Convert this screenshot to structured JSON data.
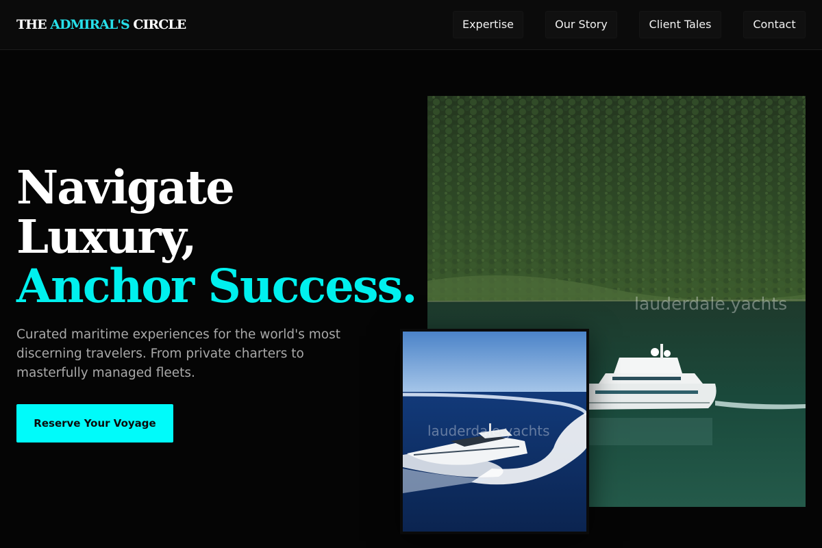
{
  "brand": {
    "part1": "THE",
    "part2": "ADMIRAL'S",
    "part3": "CIRCLE",
    "accent_color": "#27e0ea"
  },
  "nav": {
    "items": [
      {
        "label": "Expertise"
      },
      {
        "label": "Our Story"
      },
      {
        "label": "Client Tales"
      },
      {
        "label": "Contact"
      }
    ]
  },
  "hero": {
    "line1": "Navigate",
    "line2": "Luxury,",
    "line3": "Anchor Success.",
    "accent_color": "#00f0ee",
    "subtext": "Curated maritime experiences for the world's most discerning travelers. From private charters to masterfully managed fleets.",
    "cta_label": "Reserve Your Voyage",
    "cta_color": "#00fbfa"
  },
  "images": {
    "large": {
      "watermark": "lauderdale.yachts",
      "icon": "yacht-cove-photo"
    },
    "small": {
      "watermark": "lauderdale.yachts",
      "icon": "speeding-yacht-photo"
    }
  }
}
